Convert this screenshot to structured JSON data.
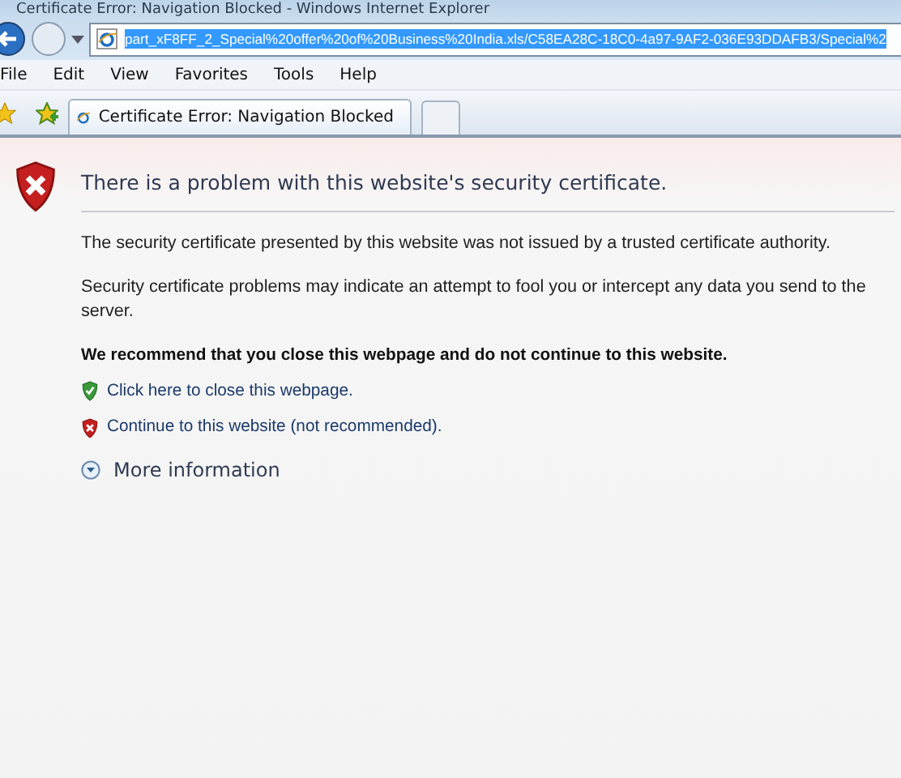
{
  "window": {
    "title": "Certificate Error: Navigation Blocked - Windows Internet Explorer"
  },
  "address_bar": {
    "url": "part_xF8FF_2_Special%20offer%20of%20Business%20India.xls/C58EA28C-18C0-4a97-9AF2-036E93DDAFB3/Special%2",
    "selected": true
  },
  "menu": [
    "File",
    "Edit",
    "View",
    "Favorites",
    "Tools",
    "Help"
  ],
  "tabs": [
    {
      "label": "Certificate Error: Navigation Blocked",
      "selected": true
    }
  ],
  "page": {
    "heading": "There is a problem with this website's security certificate.",
    "paragraphs": [
      "The security certificate presented by this website was not issued by a trusted certificate authority.",
      "Security certificate problems may indicate an attempt to fool you or intercept any data you send to the server."
    ],
    "recommendation": "We recommend that you close this webpage and do not continue to this website.",
    "actions": [
      {
        "kind": "safe",
        "label": "Click here to close this webpage."
      },
      {
        "kind": "unsafe",
        "label": "Continue to this website (not recommended)."
      }
    ],
    "more_info": {
      "label": "More information",
      "expanded": false
    }
  }
}
